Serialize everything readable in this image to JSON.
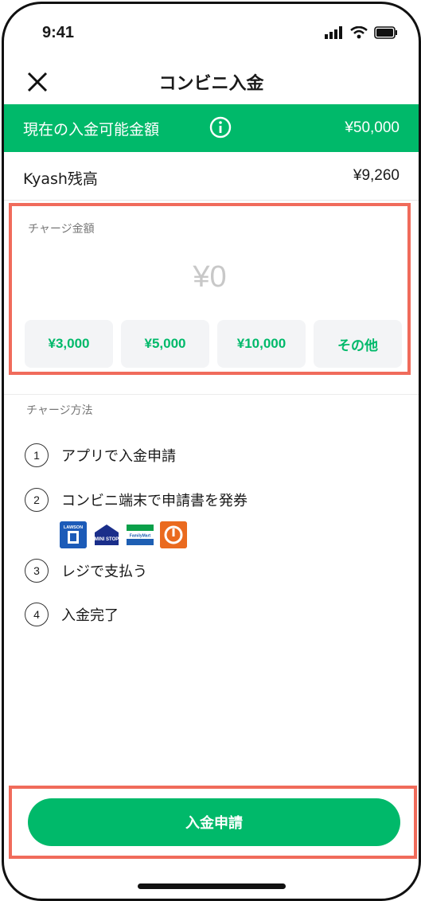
{
  "status_bar": {
    "time": "9:41"
  },
  "nav": {
    "title": "コンビニ入金"
  },
  "banner": {
    "label": "現在の入金可能金額",
    "amount": "¥50,000"
  },
  "balance": {
    "label": "Kyash残高",
    "value": "¥9,260"
  },
  "charge": {
    "label": "チャージ金額",
    "value": "¥0",
    "presets": [
      "¥3,000",
      "¥5,000",
      "¥10,000",
      "その他"
    ]
  },
  "method": {
    "label": "チャージ方法",
    "steps": [
      {
        "num": "1",
        "text": "アプリで入金申請"
      },
      {
        "num": "2",
        "text": "コンビニ端末で申請書を発券"
      },
      {
        "num": "3",
        "text": "レジで支払う"
      },
      {
        "num": "4",
        "text": "入金完了"
      }
    ],
    "store_logos": [
      {
        "name": "LAWSON",
        "label": "LAWSON"
      },
      {
        "name": "MINISTOP",
        "label": "MINI STOP"
      },
      {
        "name": "FamilyMart",
        "label": "FamilyMart"
      },
      {
        "name": "Seicomart",
        "label": ""
      }
    ]
  },
  "submit_label": "入金申請",
  "colors": {
    "accent": "#00b96a",
    "highlight": "#f06b5b"
  }
}
